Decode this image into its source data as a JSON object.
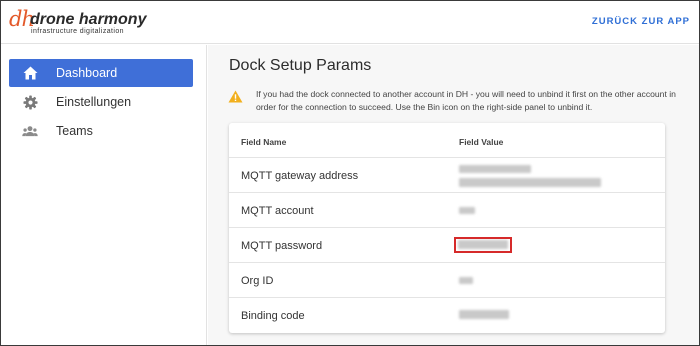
{
  "header": {
    "logo_mark": "dh",
    "logo_name": "drone harmony",
    "logo_tagline": "infrastructure digitalization",
    "back_button": "ZURÜCK ZUR APP"
  },
  "sidebar": {
    "items": [
      {
        "label": "Dashboard",
        "icon": "home-icon",
        "active": true
      },
      {
        "label": "Einstellungen",
        "icon": "gear-icon",
        "active": false
      },
      {
        "label": "Teams",
        "icon": "people-icon",
        "active": false
      }
    ]
  },
  "main": {
    "title": "Dock Setup Params",
    "warning": "If you had the dock connected to another account in DH - you will need to unbind it first on the other account in order for the connection to succeed. Use the Bin icon on the right-side panel to unbind it.",
    "table": {
      "headers": {
        "name": "Field Name",
        "value": "Field Value"
      },
      "rows": [
        {
          "name": "MQTT gateway address",
          "value_redacted": true
        },
        {
          "name": "MQTT account",
          "value_redacted": true
        },
        {
          "name": "MQTT password",
          "value_redacted": true,
          "highlighted": true
        },
        {
          "name": "Org ID",
          "value_redacted": true
        },
        {
          "name": "Binding code",
          "value_redacted": true
        }
      ]
    }
  },
  "colors": {
    "accent": "#3f6fd8",
    "link": "#2f6fd6",
    "brand_orange": "#e3592a",
    "warning": "#f2b01e",
    "highlight_border": "#d62a2a"
  }
}
